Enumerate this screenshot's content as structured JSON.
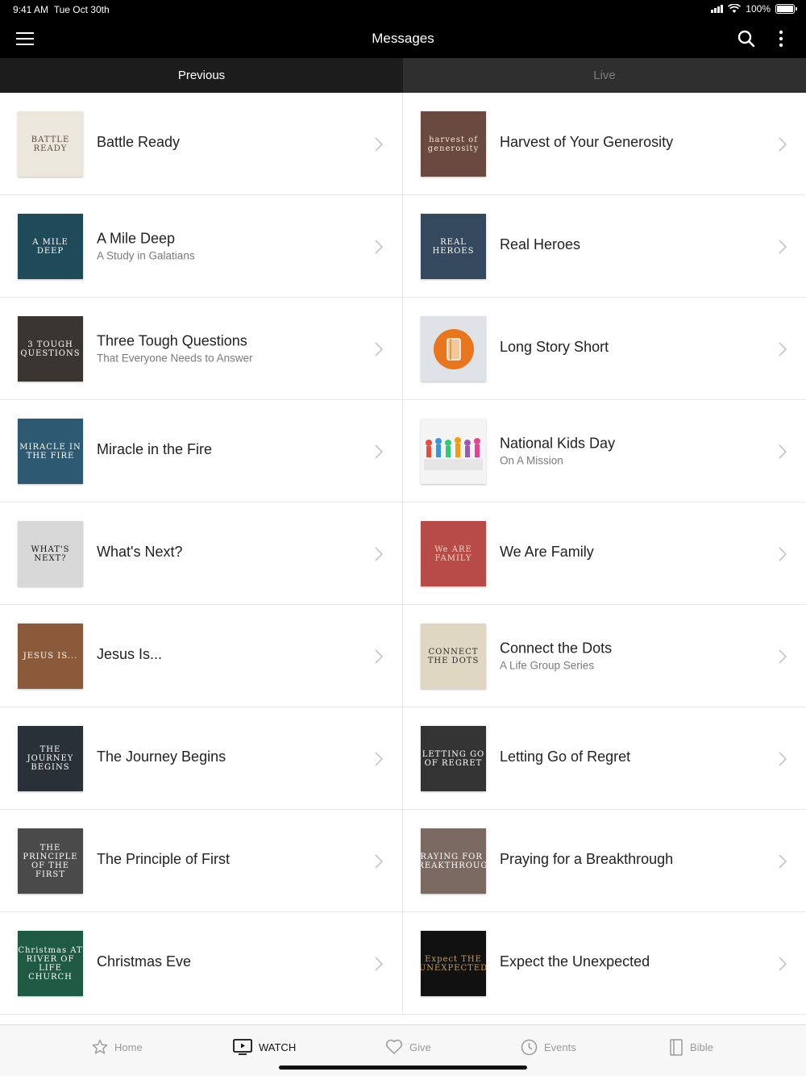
{
  "status_bar": {
    "time": "9:41 AM",
    "date": "Tue Oct 30th",
    "battery": "100%"
  },
  "header": {
    "title": "Messages"
  },
  "tabs": [
    {
      "label": "Previous",
      "active": true
    },
    {
      "label": "Live",
      "active": false
    }
  ],
  "left_items": [
    {
      "title": "Battle Ready",
      "subtitle": "",
      "thumb_text": "BATTLE READY",
      "thumb_bg": "#ece7dc",
      "thumb_fg": "#5a4a3a"
    },
    {
      "title": "A Mile Deep",
      "subtitle": "A Study in Galatians",
      "thumb_text": "A MILE DEEP",
      "thumb_bg": "#1e4a5a",
      "thumb_fg": "#ffffff"
    },
    {
      "title": "Three Tough Questions",
      "subtitle": "That Everyone Needs to Answer",
      "thumb_text": "3 TOUGH QUESTIONS",
      "thumb_bg": "#3a3530",
      "thumb_fg": "#ffffff"
    },
    {
      "title": "Miracle in the Fire",
      "subtitle": "",
      "thumb_text": "MIRACLE IN THE FIRE",
      "thumb_bg": "#2d5a72",
      "thumb_fg": "#ffffff"
    },
    {
      "title": "What's Next?",
      "subtitle": "",
      "thumb_text": "WHAT'S NEXT?",
      "thumb_bg": "#d8d8d8",
      "thumb_fg": "#111111"
    },
    {
      "title": "Jesus Is...",
      "subtitle": "",
      "thumb_text": "JESUS IS...",
      "thumb_bg": "#8a5a3a",
      "thumb_fg": "#ffffff"
    },
    {
      "title": "The Journey Begins",
      "subtitle": "",
      "thumb_text": "THE JOURNEY BEGINS",
      "thumb_bg": "#2a3038",
      "thumb_fg": "#ffffff"
    },
    {
      "title": "The Principle of First",
      "subtitle": "",
      "thumb_text": "THE PRINCIPLE OF THE FIRST",
      "thumb_bg": "#4a4a4a",
      "thumb_fg": "#ffffff"
    },
    {
      "title": "Christmas Eve",
      "subtitle": "",
      "thumb_text": "Christmas AT RIVER OF LIFE CHURCH",
      "thumb_bg": "#1f5a45",
      "thumb_fg": "#ffffff"
    }
  ],
  "right_items": [
    {
      "title": "Harvest of Your Generosity",
      "subtitle": "",
      "thumb_text": "harvest of generosity",
      "thumb_bg": "#6a4a40",
      "thumb_fg": "#f4e6d0"
    },
    {
      "title": "Real Heroes",
      "subtitle": "",
      "thumb_text": "REAL HEROES",
      "thumb_bg": "#34495e",
      "thumb_fg": "#ffffff"
    },
    {
      "title": "Long Story Short",
      "subtitle": "",
      "thumb_text": "",
      "thumb_bg": "#dfe3e8",
      "thumb_fg": "#e8761c"
    },
    {
      "title": "National Kids Day",
      "subtitle": "On A Mission",
      "thumb_text": "",
      "thumb_bg": "#f4f4f4",
      "thumb_fg": "#444444"
    },
    {
      "title": "We Are Family",
      "subtitle": "",
      "thumb_text": "We ARE FAMILY",
      "thumb_bg": "#b84a48",
      "thumb_fg": "#f5d8c8"
    },
    {
      "title": "Connect the Dots",
      "subtitle": "A Life Group Series",
      "thumb_text": "CONNECT THE DOTS",
      "thumb_bg": "#e0d7c2",
      "thumb_fg": "#2a2a2a"
    },
    {
      "title": "Letting Go of Regret",
      "subtitle": "",
      "thumb_text": "LETTING GO OF REGRET",
      "thumb_bg": "#333333",
      "thumb_fg": "#ffffff"
    },
    {
      "title": "Praying for a Breakthrough",
      "subtitle": "",
      "thumb_text": "PRAYING FOR A BREAKTHROUGH",
      "thumb_bg": "#7a6a62",
      "thumb_fg": "#ffffff"
    },
    {
      "title": "Expect the Unexpected",
      "subtitle": "",
      "thumb_text": "Expect THE UNEXPECTED",
      "thumb_bg": "#111111",
      "thumb_fg": "#c9a054"
    }
  ],
  "tab_bar": [
    {
      "label": "Home",
      "icon": "star-icon",
      "active": false
    },
    {
      "label": "WATCH",
      "icon": "tv-icon",
      "active": true
    },
    {
      "label": "Give",
      "icon": "heart-icon",
      "active": false
    },
    {
      "label": "Events",
      "icon": "clock-icon",
      "active": false
    },
    {
      "label": "Bible",
      "icon": "book-icon",
      "active": false
    }
  ]
}
